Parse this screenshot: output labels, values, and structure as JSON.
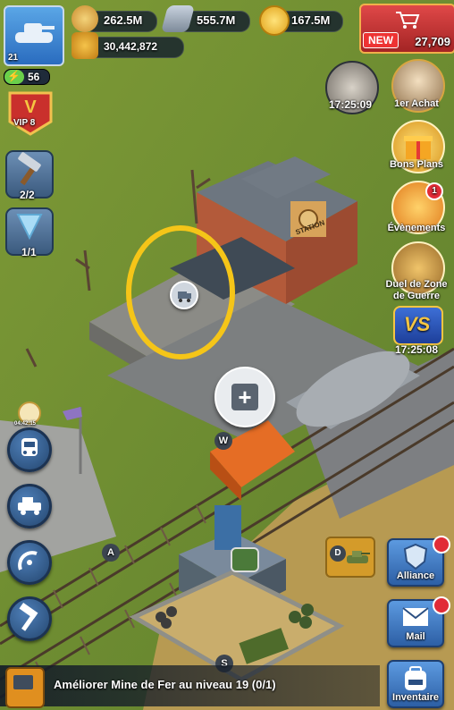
{
  "player": {
    "level": "21",
    "energy": "56",
    "vip": "VIP 8",
    "power": "30,442,872"
  },
  "resources": {
    "food": "262.5M",
    "iron": "555.7M",
    "gold": "167.5M",
    "gems": "27,709",
    "new_badge": "NEW"
  },
  "left_tools": {
    "hammer_count": "2/2",
    "drill_count": "1/1"
  },
  "right_menu": {
    "timer1": "17:25:09",
    "premier_achat": "1er Achat",
    "bons_plans": "Bons Plans",
    "evenements": "Évènements",
    "evenements_badge": "1",
    "duel_line1": "Duel de Zone",
    "duel_line2": "de Guerre",
    "vs_timer": "17:25:08",
    "vs_text": "VS"
  },
  "map": {
    "station_sign": "STATION",
    "marker_w": "W",
    "marker_a": "A",
    "marker_s": "S",
    "marker_d": "D",
    "plus": "+",
    "small_timer": "04:42:15"
  },
  "bottom_right": {
    "alliance": "Alliance",
    "mail": "Mail",
    "inventaire": "Inventaire"
  },
  "quest": {
    "text": "Améliorer Mine de Fer au niveau 19 (0/1)"
  },
  "colors": {
    "highlight_circle": "#f5c518",
    "panel": "#1b2636",
    "accent_blue": "#3a77c8"
  }
}
